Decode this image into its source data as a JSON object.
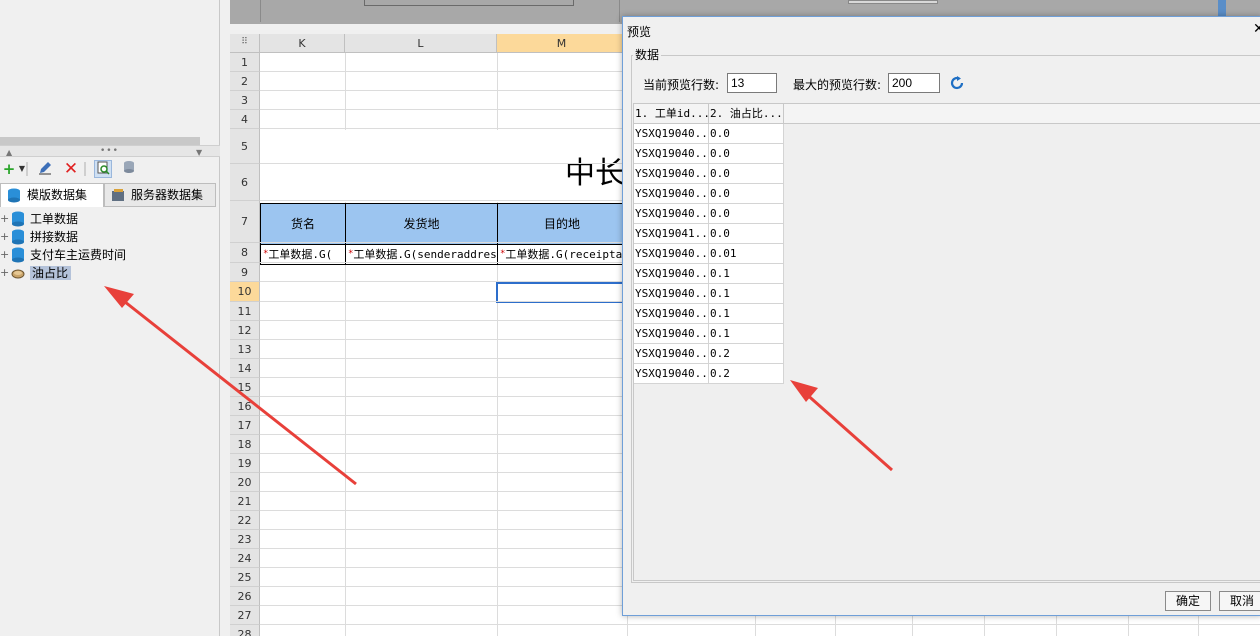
{
  "left_panel": {
    "tabs": [
      {
        "label": "模版数据集"
      },
      {
        "label": "服务器数据集"
      }
    ],
    "tree": [
      {
        "label": "工单数据"
      },
      {
        "label": "拼接数据"
      },
      {
        "label": "支付车主运费时间"
      },
      {
        "label": "油占比"
      }
    ]
  },
  "sheet": {
    "columns": [
      "K",
      "L",
      "M"
    ],
    "rows": [
      "1",
      "2",
      "3",
      "4",
      "5",
      "6",
      "7",
      "8",
      "9",
      "10",
      "11",
      "12",
      "13",
      "14",
      "15",
      "16",
      "17",
      "18",
      "19",
      "20",
      "21",
      "22",
      "23",
      "24",
      "25",
      "26",
      "27",
      "28"
    ],
    "title": "中长",
    "header_cells": [
      "货名",
      "发货地",
      "目的地"
    ],
    "bound_cells": [
      "工单数据.G(",
      "工单数据.G(senderaddress",
      "工单数据.G(receiptad"
    ]
  },
  "dialog": {
    "title": "预览",
    "group_label": "数据",
    "current_rows_label": "当前预览行数:",
    "current_rows_value": "13",
    "max_rows_label": "最大的预览行数:",
    "max_rows_value": "200",
    "columns": [
      "1. 工单id...",
      "2. 油占比..."
    ],
    "rows": [
      [
        "YSXQ19040...",
        "0.0"
      ],
      [
        "YSXQ19040...",
        "0.0"
      ],
      [
        "YSXQ19040...",
        "0.0"
      ],
      [
        "YSXQ19040...",
        "0.0"
      ],
      [
        "YSXQ19040...",
        "0.0"
      ],
      [
        "YSXQ19041...",
        "0.0"
      ],
      [
        "YSXQ19040...",
        "0.01"
      ],
      [
        "YSXQ19040...",
        "0.1"
      ],
      [
        "YSXQ19040...",
        "0.1"
      ],
      [
        "YSXQ19040...",
        "0.1"
      ],
      [
        "YSXQ19040...",
        "0.1"
      ],
      [
        "YSXQ19040...",
        "0.2"
      ],
      [
        "YSXQ19040...",
        "0.2"
      ]
    ],
    "ok_label": "确定",
    "cancel_label": "取消"
  },
  "colors": {
    "header_fill": "#9cc5f0",
    "active_header": "#fcd99a",
    "selection": "#2d6ecb",
    "annotation_arrow": "#e8403a"
  }
}
